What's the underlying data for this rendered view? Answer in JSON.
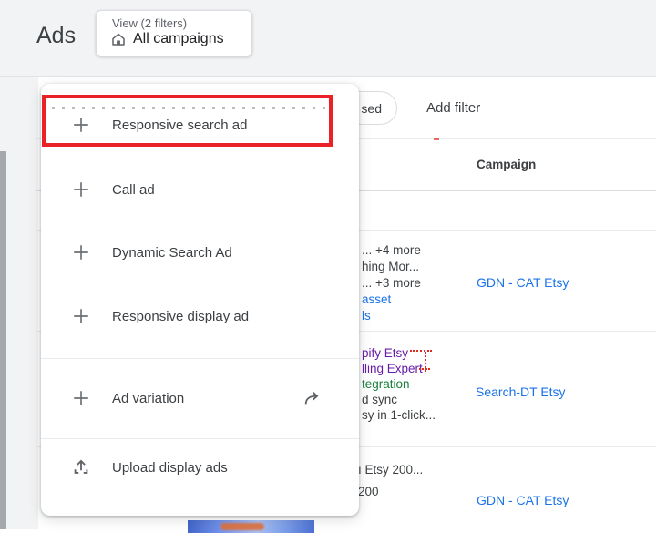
{
  "header": {
    "title": "Ads",
    "view_button": {
      "caption": "View (2 filters)",
      "value": "All campaigns",
      "icon": "home-icon"
    }
  },
  "toolbar": {
    "filter_chip_text": "sed",
    "add_filter_label": "Add filter"
  },
  "menu": {
    "items": [
      {
        "label": "Responsive search ad",
        "icon": "plus-icon",
        "highlighted": true
      },
      {
        "label": "Call ad",
        "icon": "plus-icon"
      },
      {
        "label": "Dynamic Search Ad",
        "icon": "plus-icon"
      },
      {
        "label": "Responsive display ad",
        "icon": "plus-icon"
      },
      {
        "label": "Ad variation",
        "icon": "plus-icon",
        "trailing_icon": "forward-arrow-icon"
      },
      {
        "label": "Upload display ads",
        "icon": "upload-icon"
      }
    ]
  },
  "table": {
    "columns": [
      {
        "label": "Campaign"
      }
    ],
    "rows": [
      {
        "ad_fragments": [
          {
            "text": "...  +4 more",
            "color": "#3c4043"
          },
          {
            "text": "hing Mor...",
            "color": "#3c4043"
          },
          {
            "text": "... +3 more",
            "color": "#3c4043"
          },
          {
            "text": "asset",
            "color": "#1a73e8"
          },
          {
            "text": "ls",
            "color": "#1a73e8"
          }
        ],
        "campaign": "GDN - CAT Etsy"
      },
      {
        "ad_fragments": [
          {
            "text": "pify Etsy",
            "color": "#681da8"
          },
          {
            "text": "lling Expert",
            "color": "#681da8"
          },
          {
            "text": "tegration",
            "color": "#188038"
          },
          {
            "text": "d sync",
            "color": "#3c4043"
          },
          {
            "text": "sy in 1-click...",
            "color": "#3c4043"
          }
        ],
        "campaign": "Search-DT Etsy"
      },
      {
        "ad_fragments": [
          {
            "text": "ı Etsy 200...",
            "color": "#3c4043"
          },
          {
            "text": "200",
            "color": "#3c4043"
          }
        ],
        "campaign": "GDN - CAT Etsy"
      }
    ]
  },
  "colors": {
    "accent_blue": "#1a73e8",
    "link_visited_purple": "#681da8",
    "display_url_green": "#188038",
    "annotation_red": "#ea2127",
    "text_primary": "#3c4043",
    "text_secondary": "#5f6368",
    "band_gray": "#f1f3f4"
  }
}
